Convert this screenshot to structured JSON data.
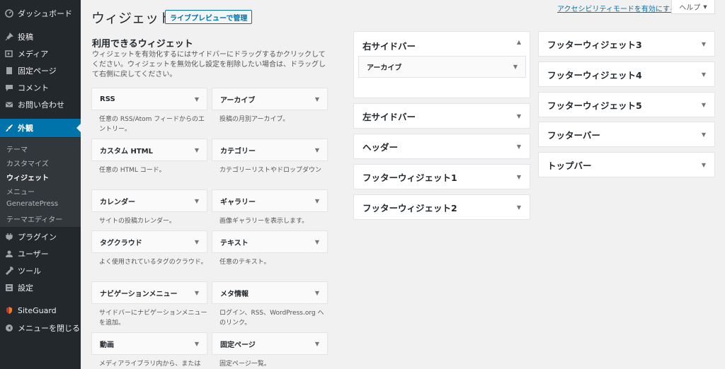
{
  "sidebar": {
    "items": [
      {
        "label": "ダッシュボード",
        "icon": "dashboard-icon"
      },
      {
        "label": "投稿",
        "icon": "pin-icon"
      },
      {
        "label": "メディア",
        "icon": "media-icon"
      },
      {
        "label": "固定ページ",
        "icon": "page-icon"
      },
      {
        "label": "コメント",
        "icon": "comment-icon"
      },
      {
        "label": "お問い合わせ",
        "icon": "mail-icon"
      },
      {
        "label": "外観",
        "icon": "brush-icon"
      },
      {
        "label": "プラグイン",
        "icon": "plugin-icon"
      },
      {
        "label": "ユーザー",
        "icon": "user-icon"
      },
      {
        "label": "ツール",
        "icon": "wrench-icon"
      },
      {
        "label": "設定",
        "icon": "settings-icon"
      },
      {
        "label": "SiteGuard",
        "icon": "siteguard-icon"
      },
      {
        "label": "メニューを閉じる",
        "icon": "collapse-icon"
      }
    ],
    "submenu": [
      "テーマ",
      "カスタマイズ",
      "ウィジェット",
      "メニュー",
      "GeneratePress",
      "テーマエディター"
    ]
  },
  "header": {
    "title": "ウィジェット",
    "live_preview": "ライブプレビューで管理",
    "a11y_link": "アクセシビリティモードを有効にする",
    "help": "ヘルプ"
  },
  "available": {
    "title": "利用できるウィジェット",
    "description": "ウィジェットを有効化するにはサイドバーにドラッグするかクリックしてください。ウィジェットを無効化し設定を削除したい場合は、ドラッグして右側に戻してください。",
    "widgets": [
      {
        "name": "RSS",
        "desc": "任意の RSS/Atom フィードからのエントリー。"
      },
      {
        "name": "アーカイブ",
        "desc": "投稿の月別アーカイブ。"
      },
      {
        "name": "カスタム HTML",
        "desc": "任意の HTML コード。"
      },
      {
        "name": "カテゴリー",
        "desc": "カテゴリーリストやドロップダウン"
      },
      {
        "name": "カレンダー",
        "desc": "サイトの投稿カレンダー。"
      },
      {
        "name": "ギャラリー",
        "desc": "画像ギャラリーを表示します。"
      },
      {
        "name": "タグクラウド",
        "desc": "よく使用されているタグのクラウド。"
      },
      {
        "name": "テキスト",
        "desc": "任意のテキスト。"
      },
      {
        "name": "ナビゲーションメニュー",
        "desc": "サイドバーにナビゲーションメニューを追加。"
      },
      {
        "name": "メタ情報",
        "desc": "ログイン、RSS、WordPress.org へのリンク。"
      },
      {
        "name": "動画",
        "desc": "メディアライブラリ内から、または"
      },
      {
        "name": "固定ページ",
        "desc": "固定ページ一覧。"
      }
    ]
  },
  "areas": {
    "col1": [
      {
        "name": "右サイドバー",
        "open": true,
        "inner": "アーカイブ"
      },
      {
        "name": "左サイドバー"
      },
      {
        "name": "ヘッダー"
      },
      {
        "name": "フッターウィジェット1"
      },
      {
        "name": "フッターウィジェット2"
      }
    ],
    "col2": [
      {
        "name": "フッターウィジェット3"
      },
      {
        "name": "フッターウィジェット4"
      },
      {
        "name": "フッターウィジェット5"
      },
      {
        "name": "フッターバー"
      },
      {
        "name": "トップバー"
      }
    ]
  },
  "colors": {
    "accent": "#0073aa",
    "sidebar": "#23282d"
  }
}
